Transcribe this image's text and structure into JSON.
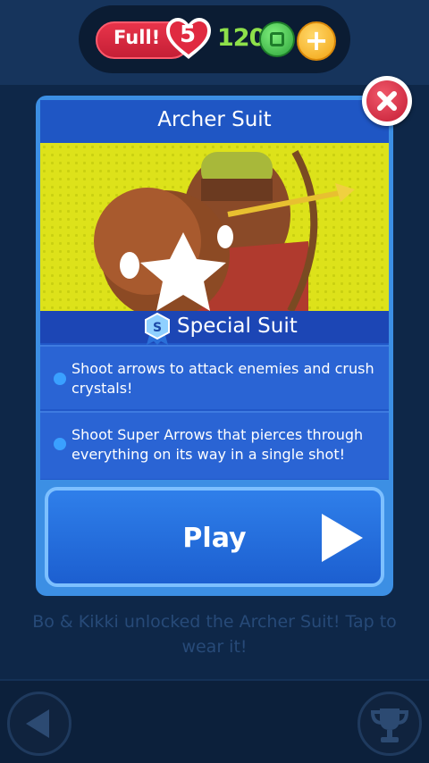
{
  "hud": {
    "lives_status": "Full!",
    "lives_count": "5",
    "coins": "120",
    "add_coins_label": "+"
  },
  "card": {
    "title": "Archer Suit",
    "suit_type_badge": "S",
    "suit_type": "Special Suit",
    "perks": [
      "Shoot arrows to attack enemies and crush crystals!",
      "Shoot Super Arrows that pierces through everything on its way in a single shot!"
    ],
    "play_label": "Play"
  },
  "hint": "Bo & Kikki unlocked the Archer Suit! Tap to wear it!",
  "colors": {
    "lives_red": "#d9283f",
    "coin_green": "#8ee04a",
    "card_blue": "#2157c8",
    "hero_yellow": "#dde21a",
    "play_blue": "#2671e0"
  },
  "icons": {
    "heart": "heart-icon",
    "coin": "coin-icon",
    "plus": "plus-icon",
    "close": "close-icon",
    "badge": "ribbon-badge-icon",
    "play": "play-triangle-icon",
    "back": "back-arrow-icon",
    "trophy": "trophy-icon"
  }
}
